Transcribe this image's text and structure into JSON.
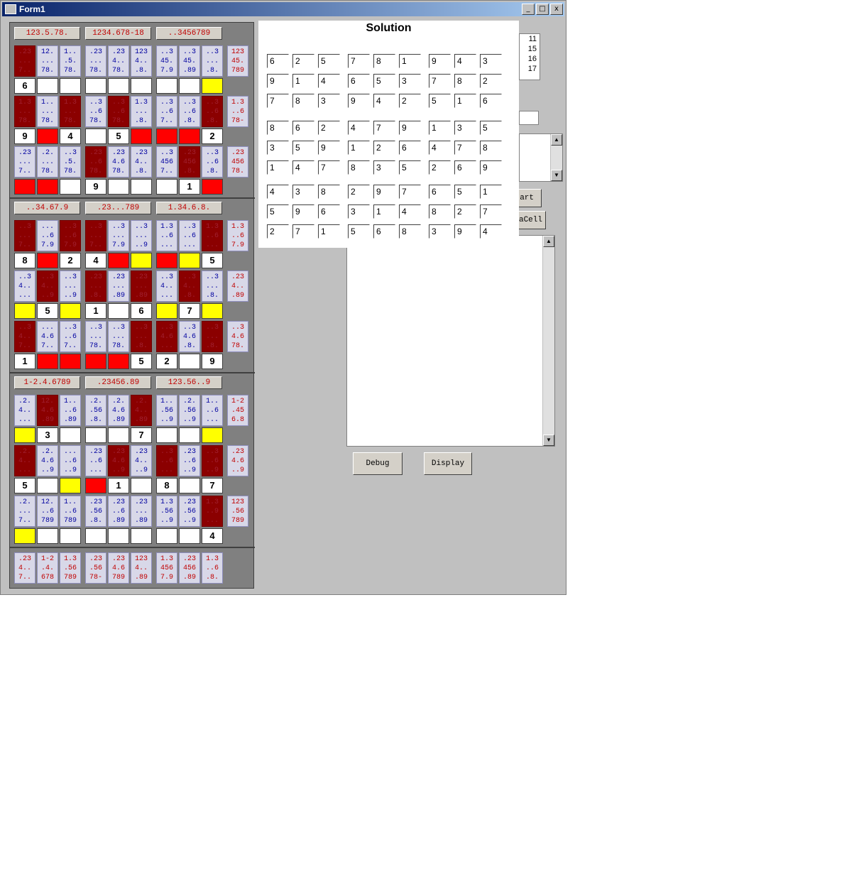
{
  "window": {
    "title": "Form1",
    "min": "_",
    "max": "□",
    "close": "x"
  },
  "solution": {
    "title": "Solution",
    "grid": [
      [
        "6",
        "2",
        "5",
        "7",
        "8",
        "1",
        "9",
        "4",
        "3"
      ],
      [
        "9",
        "1",
        "4",
        "6",
        "5",
        "3",
        "7",
        "8",
        "2"
      ],
      [
        "7",
        "8",
        "3",
        "9",
        "4",
        "2",
        "5",
        "1",
        "6"
      ],
      [
        "8",
        "6",
        "2",
        "4",
        "7",
        "9",
        "1",
        "3",
        "5"
      ],
      [
        "3",
        "5",
        "9",
        "1",
        "2",
        "6",
        "4",
        "7",
        "8"
      ],
      [
        "1",
        "4",
        "7",
        "8",
        "3",
        "5",
        "2",
        "6",
        "9"
      ],
      [
        "4",
        "3",
        "8",
        "2",
        "9",
        "7",
        "6",
        "5",
        "1"
      ],
      [
        "5",
        "9",
        "6",
        "3",
        "1",
        "4",
        "8",
        "2",
        "7"
      ],
      [
        "2",
        "7",
        "1",
        "5",
        "6",
        "8",
        "3",
        "9",
        "4"
      ]
    ]
  },
  "side_list": [
    "11",
    "15",
    "16",
    "17"
  ],
  "buttons": {
    "start": "art",
    "add_cell": "d_aCell",
    "debug": "Debug",
    "display": "Display"
  },
  "sudoku": {
    "bands": [
      {
        "headers": [
          "123.5.78.",
          "1234.678-18",
          "..3456789"
        ],
        "rows": [
          {
            "cands": [
              ".23\n...\n7..",
              "12.\n...\n78.",
              "1..\n.5.\n78.",
              ".23\n...\n78.",
              ".23\n4..\n78.",
              "123\n4..\n.8.",
              "..3\n45.\n7.9",
              "..3\n45.\n.89",
              "..3\n...\n.8."
            ],
            "dark": [
              1,
              0,
              0,
              0,
              0,
              0,
              0,
              0,
              0
            ],
            "vals": [
              "6",
              "",
              "",
              "",
              "",
              "",
              "",
              "",
              ""
            ],
            "vstate": [
              "w",
              "w",
              "w",
              "w",
              "w",
              "w",
              "w",
              "w",
              "y"
            ],
            "sum": "123\n45.\n789"
          },
          {
            "cands": [
              "1.3\n...\n78.",
              "1..\n...\n78.",
              "1.3\n...\n78.",
              "..3\n..6\n78.",
              "..3\n..6\n78.",
              "1.3\n...\n.8.",
              "..3\n..6\n7..",
              "..3\n..6\n.8.",
              "..3\n..6\n.8."
            ],
            "dark": [
              1,
              0,
              1,
              0,
              1,
              0,
              0,
              0,
              1
            ],
            "vals": [
              "9",
              "",
              "4",
              "",
              "5",
              "",
              "",
              "",
              "2"
            ],
            "vstate": [
              "w",
              "r",
              "w",
              "w",
              "w",
              "r",
              "r",
              "r",
              "w"
            ],
            "sum": "1.3\n..6\n78-"
          },
          {
            "cands": [
              ".23\n...\n7..",
              ".2.\n...\n78.",
              "..3\n.5.\n78.",
              ".23\n..6\n78.",
              ".23\n4.6\n78.",
              ".23\n4..\n.8.",
              "..3\n456\n7..",
              ".23\n456\n.8.",
              "..3\n..6\n.8."
            ],
            "dark": [
              0,
              0,
              0,
              1,
              0,
              0,
              0,
              1,
              0
            ],
            "vals": [
              "",
              "",
              "",
              "9",
              "",
              "",
              "",
              "1",
              ""
            ],
            "vstate": [
              "r",
              "r",
              "w",
              "w",
              "w",
              "w",
              "w",
              "w",
              "r"
            ],
            "sum": ".23\n456\n78."
          }
        ]
      },
      {
        "headers": [
          "..34.67.9",
          ".23...789",
          "1.34.6.8."
        ],
        "rows": [
          {
            "cands": [
              "..3\n...\n7..",
              "...\n..6\n7.9",
              "..3\n..6\n7.9",
              "..3\n...\n7..",
              "..3\n...\n7.9",
              "..3\n...\n..9",
              "1.3\n..6\n...",
              "..3\n..6\n...",
              "1.3\n..6\n..."
            ],
            "dark": [
              1,
              0,
              1,
              1,
              0,
              0,
              0,
              0,
              1
            ],
            "vals": [
              "8",
              "",
              "2",
              "4",
              "",
              "",
              "",
              "",
              "5"
            ],
            "vstate": [
              "w",
              "r",
              "w",
              "w",
              "r",
              "y",
              "r",
              "y",
              "w"
            ],
            "sum": "1.3\n..6\n7.9"
          },
          {
            "cands": [
              "..3\n4..\n...",
              "..3\n4..\n..9",
              "..3\n...\n..9",
              ".23\n...\n.8.",
              ".23\n...\n.89",
              ".23\n...\n.89",
              "..3\n4..\n...",
              "..3\n4..\n.8.",
              "..3\n...\n.8."
            ],
            "dark": [
              0,
              1,
              0,
              1,
              0,
              1,
              0,
              1,
              0
            ],
            "vals": [
              "",
              "5",
              "",
              "1",
              "",
              "6",
              "",
              "7",
              ""
            ],
            "vstate": [
              "y",
              "w",
              "y",
              "w",
              "w",
              "w",
              "y",
              "w",
              "y"
            ],
            "sum": ".23\n4..\n.89"
          },
          {
            "cands": [
              "..3\n4..\n7..",
              "...\n4.6\n7..",
              "..3\n..6\n7..",
              "..3\n...\n78.",
              "..3\n...\n78.",
              "..3\n...\n.8.",
              "..3\n4.6\n...",
              "..3\n4.6\n.8.",
              "..3\n...\n.8."
            ],
            "dark": [
              1,
              0,
              0,
              0,
              0,
              1,
              1,
              0,
              1
            ],
            "vals": [
              "1",
              "",
              "",
              "",
              "",
              "5",
              "2",
              "",
              "9"
            ],
            "vstate": [
              "w",
              "r",
              "r",
              "r",
              "r",
              "w",
              "w",
              "w",
              "w"
            ],
            "sum": "..3\n4.6\n78."
          }
        ]
      },
      {
        "headers": [
          "1-2.4.6789",
          ".23456.89",
          "123.56..9"
        ],
        "rows": [
          {
            "cands": [
              ".2.\n4..\n...",
              "12.\n4.6\n.89",
              "1..\n..6\n.89",
              ".2.\n.56\n.8.",
              ".2.\n4.6\n.89",
              ".2.\n4..\n.89",
              "1..\n.56\n..9",
              ".2.\n.56\n..9",
              "1..\n..6\n..."
            ],
            "dark": [
              0,
              1,
              0,
              0,
              0,
              1,
              0,
              0,
              0
            ],
            "vals": [
              "",
              "3",
              "",
              "",
              "",
              "7",
              "",
              "",
              ""
            ],
            "vstate": [
              "y",
              "w",
              "w",
              "w",
              "w",
              "w",
              "w",
              "w",
              "y"
            ],
            "sum": "1-2\n.45\n6.8"
          },
          {
            "cands": [
              ".2.\n4..\n...",
              ".2.\n4.6\n..9",
              "...\n..6\n..9",
              ".23\n..6\n...",
              ".23\n4.6\n..9",
              ".23\n4..\n..9",
              "..3\n..6\n...",
              ".23\n..6\n..9",
              "..3\n..6\n..9"
            ],
            "dark": [
              1,
              0,
              0,
              0,
              1,
              0,
              1,
              0,
              1
            ],
            "vals": [
              "5",
              "",
              "",
              "",
              "1",
              "",
              "8",
              "",
              "7"
            ],
            "vstate": [
              "w",
              "w",
              "y",
              "r",
              "w",
              "w",
              "w",
              "w",
              "w"
            ],
            "sum": ".23\n4.6\n..9"
          },
          {
            "cands": [
              ".2.\n...\n7..",
              "12.\n..6\n789",
              "1..\n..6\n789",
              ".23\n.56\n.8.",
              ".23\n..6\n.89",
              ".23\n...\n.89",
              "1.3\n.56\n..9",
              ".23\n.56\n..9",
              "1.3\n..9\n..."
            ],
            "dark": [
              0,
              0,
              0,
              0,
              0,
              0,
              0,
              0,
              1
            ],
            "vals": [
              "",
              "",
              "",
              "",
              "",
              "",
              "",
              "",
              "4"
            ],
            "vstate": [
              "y",
              "w",
              "w",
              "w",
              "w",
              "w",
              "w",
              "w",
              "w"
            ],
            "sum": "123\n.56\n789"
          }
        ]
      }
    ],
    "colsums": [
      ".23\n4..\n7..",
      "1-2\n.4.\n678",
      "1.3\n.56\n789",
      ".23\n.56\n78-",
      ".23\n4.6\n789",
      "123\n4..\n.89",
      "1.3\n456\n7.9",
      ".23\n456\n.89",
      "1.3\n..6\n.8."
    ]
  }
}
